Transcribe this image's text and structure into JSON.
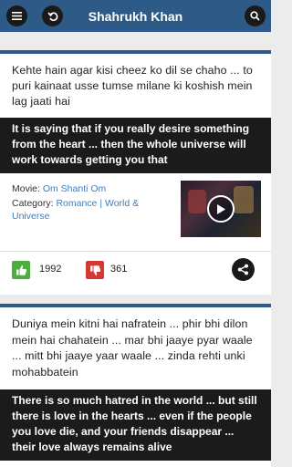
{
  "app": {
    "title": "Shahrukh Khan",
    "colors": {
      "appbar": "#2d5a86",
      "like": "#4cae3c",
      "dislike": "#d23b32",
      "link": "#3a7fc5"
    },
    "icons": {
      "menu": "menu-icon",
      "back": "back-icon",
      "search": "search-icon",
      "like": "thumbs-up-icon",
      "dislike": "thumbs-down-icon",
      "share": "share-icon",
      "play": "play-icon"
    }
  },
  "quotes": [
    {
      "original": "Kehte hain agar kisi cheez ko dil se chaho ... to puri kainaat usse tumse milane ki koshish mein lag jaati hai",
      "translation": "It is saying that if you really desire something from the heart ... then the whole universe will work towards getting you that",
      "movie_label": "Movie: ",
      "movie": "Om Shanti Om",
      "category_label": "Category: ",
      "category_1": "Romance",
      "category_sep": " | ",
      "category_2": "World & Universe",
      "likes": "1992",
      "dislikes": "361"
    },
    {
      "original": "Duniya mein kitni hai nafratein ... phir bhi dilon mein hai chahatein ... mar bhi jaaye pyar waale ... mitt bhi jaaye yaar waale ... zinda rehti unki mohabbatein",
      "translation": "There is so much hatred in the world ... but still there is love in the hearts ... even if the people you love die, and your friends disappear ... their love always remains alive"
    }
  ]
}
